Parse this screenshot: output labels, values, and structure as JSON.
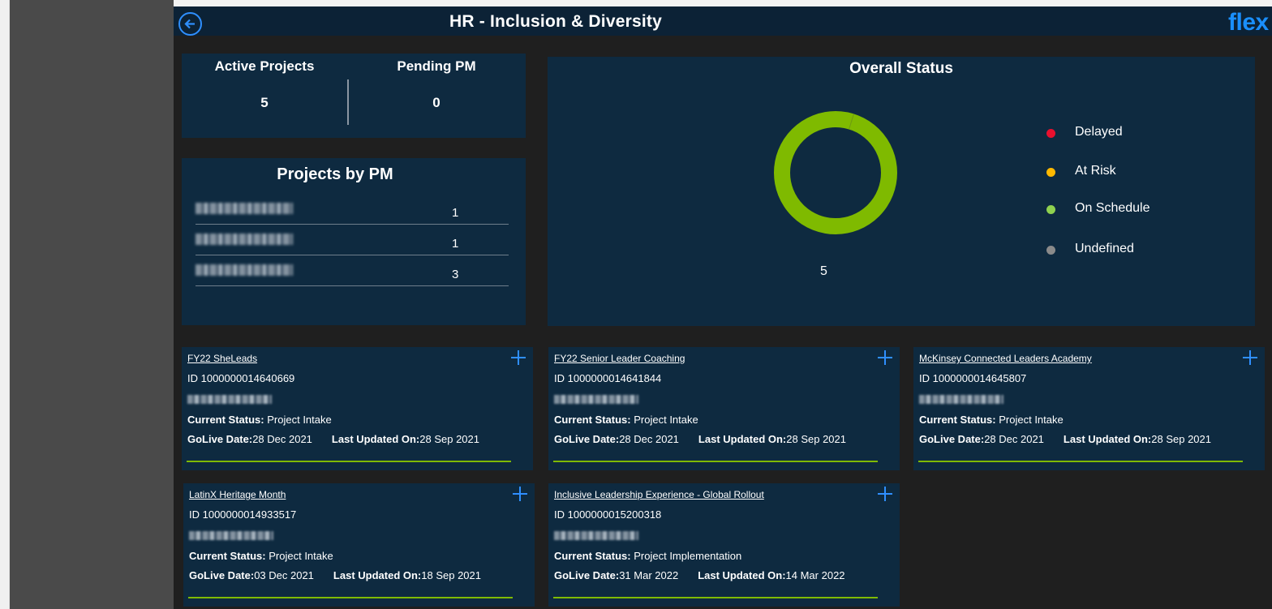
{
  "header": {
    "title": "HR - Inclusion & Diversity",
    "logo_text": "flex",
    "back_icon": "arrow-left-circle-icon"
  },
  "kpis": {
    "active_projects_label": "Active Projects",
    "active_projects_value": "5",
    "pending_pm_label": "Pending PM",
    "pending_pm_value": "0"
  },
  "projects_by_pm": {
    "title": "Projects by PM",
    "rows": [
      {
        "name": "",
        "count": "1"
      },
      {
        "name": "",
        "count": "1"
      },
      {
        "name": "",
        "count": "3"
      }
    ]
  },
  "overall_status": {
    "title": "Overall Status",
    "total_label": "5",
    "legend": [
      {
        "label": "Delayed",
        "color": "#e8102e"
      },
      {
        "label": "At Risk",
        "color": "#ffb900"
      },
      {
        "label": "On Schedule",
        "color": "#8fd14f"
      },
      {
        "label": "Undefined",
        "color": "#8a8a8a"
      }
    ]
  },
  "chart_data": {
    "type": "pie",
    "title": "Overall Status",
    "categories": [
      "Delayed",
      "At Risk",
      "On Schedule",
      "Undefined"
    ],
    "values": [
      0,
      0,
      5,
      0
    ],
    "colors": [
      "#e8102e",
      "#ffb900",
      "#7fba00",
      "#8a8a8a"
    ],
    "total": 5,
    "legend_position": "right"
  },
  "labels": {
    "current_status": "Current Status:",
    "golive_date": "GoLive Date:",
    "last_updated_on": "Last Updated On:"
  },
  "projects": [
    {
      "name": "FY22 SheLeads",
      "id": "ID 1000000014640669",
      "current_status": "Project Intake",
      "golive_date": "28 Dec 2021",
      "last_updated": "28 Sep 2021"
    },
    {
      "name": "FY22 Senior Leader Coaching",
      "id": "ID 1000000014641844",
      "current_status": "Project Intake",
      "golive_date": "28 Dec 2021",
      "last_updated": "28 Sep 2021"
    },
    {
      "name": "McKinsey Connected Leaders Academy",
      "id": "ID 1000000014645807",
      "current_status": "Project Intake",
      "golive_date": "28 Dec 2021",
      "last_updated": "28 Sep 2021"
    },
    {
      "name": "LatinX Heritage Month",
      "id": "ID 1000000014933517",
      "current_status": "Project Intake",
      "golive_date": "03 Dec 2021",
      "last_updated": "18 Sep 2021"
    },
    {
      "name": "Inclusive Leadership Experience - Global Rollout",
      "id": "ID 1000000015200318",
      "current_status": "Project Implementation",
      "golive_date": "31 Mar 2022",
      "last_updated": "14 Mar 2022"
    }
  ]
}
